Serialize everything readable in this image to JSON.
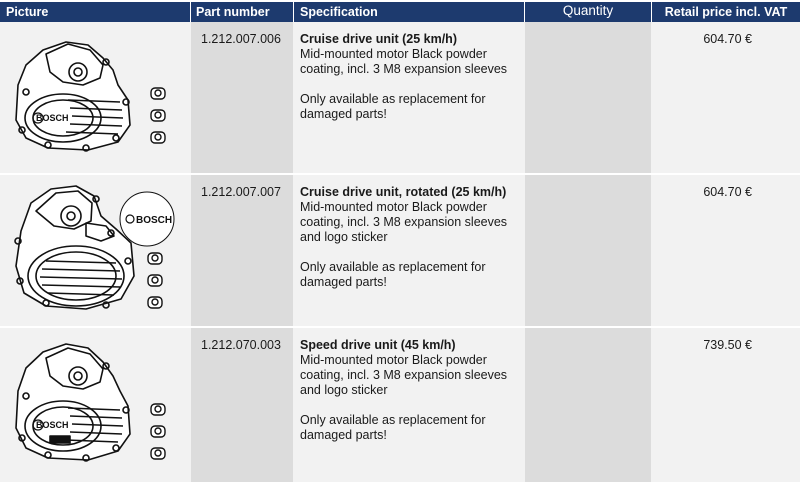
{
  "header": {
    "picture": "Picture",
    "part_number": "Part number",
    "specification": "Specification",
    "quantity": "Quantity",
    "price": "Retail price incl. VAT"
  },
  "colors": {
    "header_bg": "#1d3a6e",
    "row_light": "#f2f2f2",
    "row_dark": "#dcdcdc"
  },
  "rows": [
    {
      "part_number": "1.212.007.006",
      "title": "Cruise drive unit (25 km/h)",
      "description": "Mid-mounted motor Black powder coating, incl. 3 M8 expansion sleeves",
      "note": "Only available as replacement for damaged parts!",
      "price": "604.70 €",
      "image": "drive-unit-with-bolts",
      "logo": "BOSCH"
    },
    {
      "part_number": "1.212.007.007",
      "title": "Cruise drive unit, rotated (25 km/h)",
      "description": "Mid-mounted motor Black powder coating, incl. 3 M8 expansion sleeves and logo sticker",
      "note": "Only available as replacement for damaged parts!",
      "price": "604.70 €",
      "image": "drive-unit-rotated-with-sticker-and-bolts",
      "logo": "BOSCH"
    },
    {
      "part_number": "1.212.070.003",
      "title": "Speed drive unit (45 km/h)",
      "description": "Mid-mounted motor Black powder coating, incl. 3 M8 expansion sleeves and logo sticker",
      "note": "Only available as replacement for damaged parts!",
      "price": "739.50 €",
      "image": "drive-unit-speed-with-bolts",
      "logo": "BOSCH"
    }
  ]
}
